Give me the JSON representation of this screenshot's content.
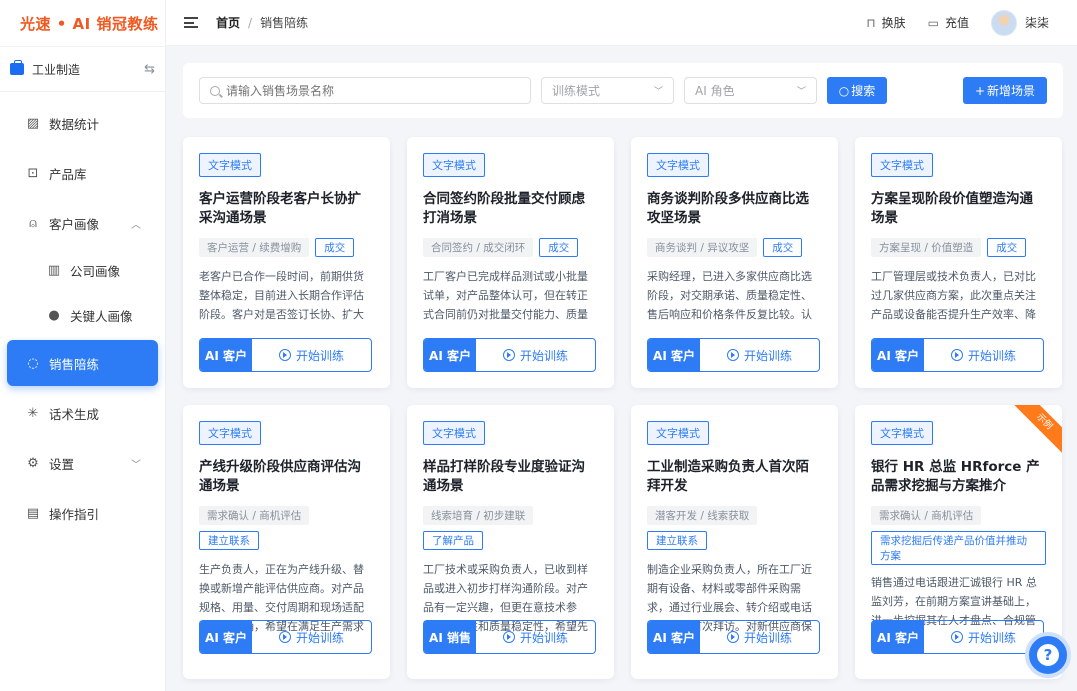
{
  "app": {
    "logo": "光速 • AI 销冠教练"
  },
  "workspace": {
    "label": "工业制造",
    "switch_icon": "⇆"
  },
  "sidebar": {
    "items": [
      {
        "label": "数据统计",
        "icon": "chart-icon",
        "glyph": "📈"
      },
      {
        "label": "产品库",
        "icon": "box-icon",
        "glyph": "🗃"
      },
      {
        "label": "客户画像",
        "icon": "user-icon",
        "glyph": "👤",
        "chevron": "︿"
      },
      {
        "label": "公司画像",
        "icon": "building-icon",
        "glyph": "🏢"
      },
      {
        "label": "关键人画像",
        "icon": "person-icon",
        "glyph": "👤"
      },
      {
        "label": "销售陪练",
        "icon": "chat-icon",
        "glyph": "💬"
      },
      {
        "label": "话术生成",
        "icon": "sparkle-icon",
        "glyph": "✳"
      },
      {
        "label": "设置",
        "icon": "gear-icon",
        "glyph": "⚙",
        "chevron": "﹀"
      },
      {
        "label": "操作指引",
        "icon": "doc-icon",
        "glyph": "📄"
      }
    ]
  },
  "header": {
    "breadcrumb": {
      "home": "首页",
      "separator": "/",
      "current": "销售陪练"
    },
    "skin": "换肤",
    "recharge": "充值",
    "user": "柒柒"
  },
  "toolbar": {
    "search_placeholder": "请输入销售场景名称",
    "mode_placeholder": "训练模式",
    "role_placeholder": "AI 角色",
    "search_btn": "搜索",
    "add_btn": "新增场景",
    "add_prefix": "+",
    "search_prefix": "○"
  },
  "cards": [
    {
      "mode": "文字模式",
      "title": "客户运营阶段老客户长协扩采沟通场景",
      "tag": "客户运营 / 续费增购",
      "stage": "成交",
      "desc": "老客户已合作一段时间，前期供货整体稳定，目前进入长期合作评估阶段。客户对是否签订长协、扩大采…",
      "role": "AI 客户",
      "start": "开始训练"
    },
    {
      "mode": "文字模式",
      "title": "合同签约阶段批量交付顾虑打消场景",
      "tag": "合同签约 / 成交闭环",
      "stage": "成交",
      "desc": "工厂客户已完成样品测试或小批量试单，对产品整体认可，但在转正式合同前仍对批量交付能力、质量一致…",
      "role": "AI 客户",
      "start": "开始训练"
    },
    {
      "mode": "文字模式",
      "title": "商务谈判阶段多供应商比选攻坚场景",
      "tag": "商务谈判 / 异议攻坚",
      "stage": "成交",
      "desc": "采购经理，已进入多家供应商比选阶段，对交期承诺、质量稳定性、售后响应和价格条件反复比较。认可合…",
      "role": "AI 客户",
      "start": "开始训练"
    },
    {
      "mode": "文字模式",
      "title": "方案呈现阶段价值塑造沟通场景",
      "tag": "方案呈现 / 价值塑造",
      "stage": "成交",
      "desc": "工厂管理层或技术负责人，已对比过几家供应商方案，此次重点关注产品或设备能否提升生产效率、降低损…",
      "role": "AI 客户",
      "start": "开始训练"
    },
    {
      "mode": "文字模式",
      "title": "产线升级阶段供应商评估沟通场景",
      "tag": "需求确认 / 商机评估",
      "stage": "建立联系",
      "desc": "生产负责人，正在为产线升级、替换或新增产能评估供应商。对产品规格、用量、交付周期和现场适配要…较明确，希望在满足生产需求的同时控制采购风险。",
      "role": "AI 客户",
      "start": "开始训练"
    },
    {
      "mode": "文字模式",
      "title": "样品打样阶段专业度验证沟通场景",
      "tag": "线索培育 / 初步建联",
      "stage": "了解产品",
      "desc": "工厂技术或采购负责人，已收到样品或进入初步打样沟通阶段。对产品有一定兴趣，但更在意技术参数、适…性和质量稳定性，希望先确认你们是否真的专业可靠。",
      "role": "AI 销售",
      "start": "开始训练"
    },
    {
      "mode": "文字模式",
      "title": "工业制造采购负责人首次陌拜开发",
      "tag": "潜客开发 / 线索获取",
      "stage": "建立联系",
      "desc": "制造企业采购负责人，所在工厂近期有设备、材料或零部件采购需求，通过行业展会、转介绍或电话邀约建…首次拜访。对新供应商保持谨慎，更关注对方是否具备稳定交付和现场服务能力。",
      "role": "AI 客户",
      "start": "开始训练"
    },
    {
      "mode": "文字模式",
      "title": "银行 HR 总监 HRforce 产品需求挖掘与方案推介",
      "tag": "需求确认 / 商机评估",
      "stage": "需求挖掘后传递产品价值并推动方案",
      "desc": "销售通过电话跟进汇诚银行 HR 总监刘芳，在前期方案宣讲基础上，进一步挖掘其在人才盘点、合规管理方…",
      "role": "AI 客户",
      "start": "开始训练",
      "ribbon": "示例"
    }
  ],
  "help": {
    "label": "?"
  },
  "colors": {
    "brand": "#f05a22",
    "primary": "#2d7cf6",
    "ribbon": "#ff7a1a"
  }
}
